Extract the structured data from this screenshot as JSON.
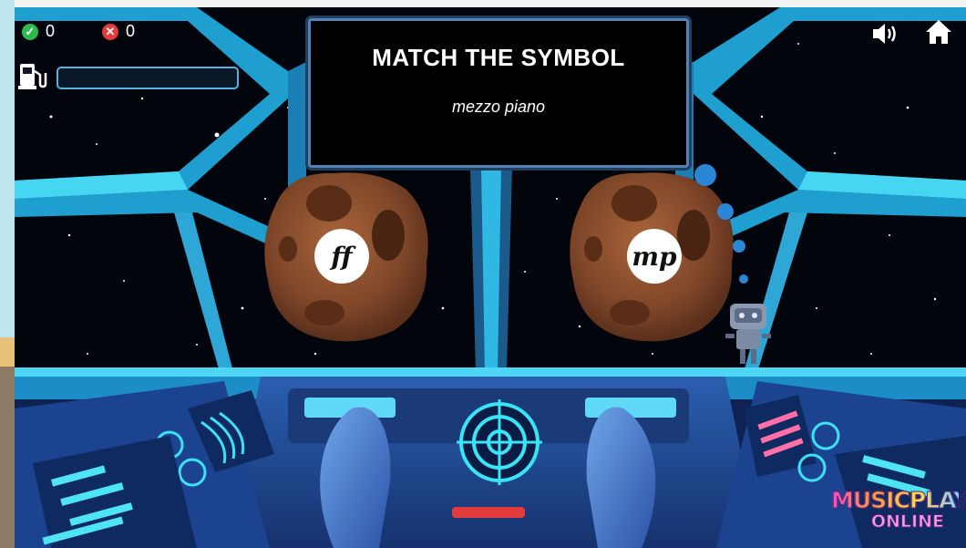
{
  "hud": {
    "correct_count": "0",
    "wrong_count": "0",
    "fuel_level_percent": 0
  },
  "icons": {
    "correct": "check-circle-icon",
    "wrong": "x-circle-icon",
    "fuel": "fuel-pump-icon",
    "sound": "speaker-icon",
    "home": "home-icon"
  },
  "prompt": {
    "title": "MATCH THE SYMBOL",
    "term": "mezzo piano"
  },
  "answers": [
    {
      "symbol": "ff"
    },
    {
      "symbol": "mp"
    }
  ],
  "brand": {
    "line1": "MUSICPLAY",
    "line2": "ONLINE"
  },
  "colors": {
    "frame": "#1f9fd0",
    "frame_light": "#47d6f2",
    "console": "#1a3f86",
    "asteroid": "#8b4f2e",
    "correct": "#2dbb4f",
    "wrong": "#e23b3b"
  }
}
